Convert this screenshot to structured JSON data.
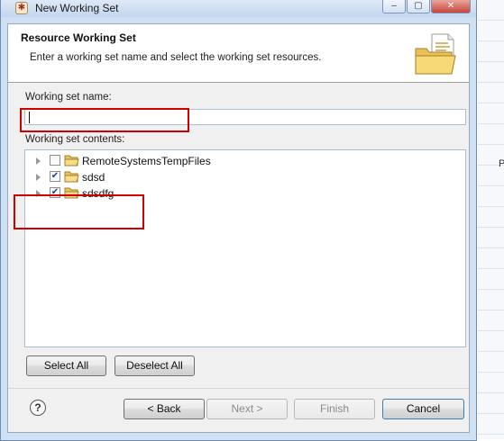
{
  "window": {
    "title": "New Working Set",
    "minimize_glyph": "–",
    "maximize_glyph": "▢",
    "close_glyph": "✕"
  },
  "banner": {
    "title": "Resource Working Set",
    "description": "Enter a working set name and select the working set resources.",
    "icon": "folder-document-icon"
  },
  "name_field": {
    "label": "Working set name:",
    "value": ""
  },
  "contents": {
    "label": "Working set contents:",
    "items": [
      {
        "label": "RemoteSystemsTempFiles",
        "checked": false,
        "icon": "folder-icon"
      },
      {
        "label": "sdsd",
        "checked": true,
        "icon": "folder-icon"
      },
      {
        "label": "sdsdfg",
        "checked": true,
        "icon": "folder-icon"
      }
    ]
  },
  "selection_buttons": {
    "select_all": "Select All",
    "deselect_all": "Deselect All"
  },
  "footer": {
    "help_glyph": "?",
    "back": "< Back",
    "next": "Next >",
    "finish": "Finish",
    "cancel": "Cancel"
  },
  "background": {
    "peek_letter": "P"
  },
  "colors": {
    "highlight": "#d00000",
    "window_frame": "#cfe0f3",
    "dialog_bg": "#f0f0f0"
  }
}
